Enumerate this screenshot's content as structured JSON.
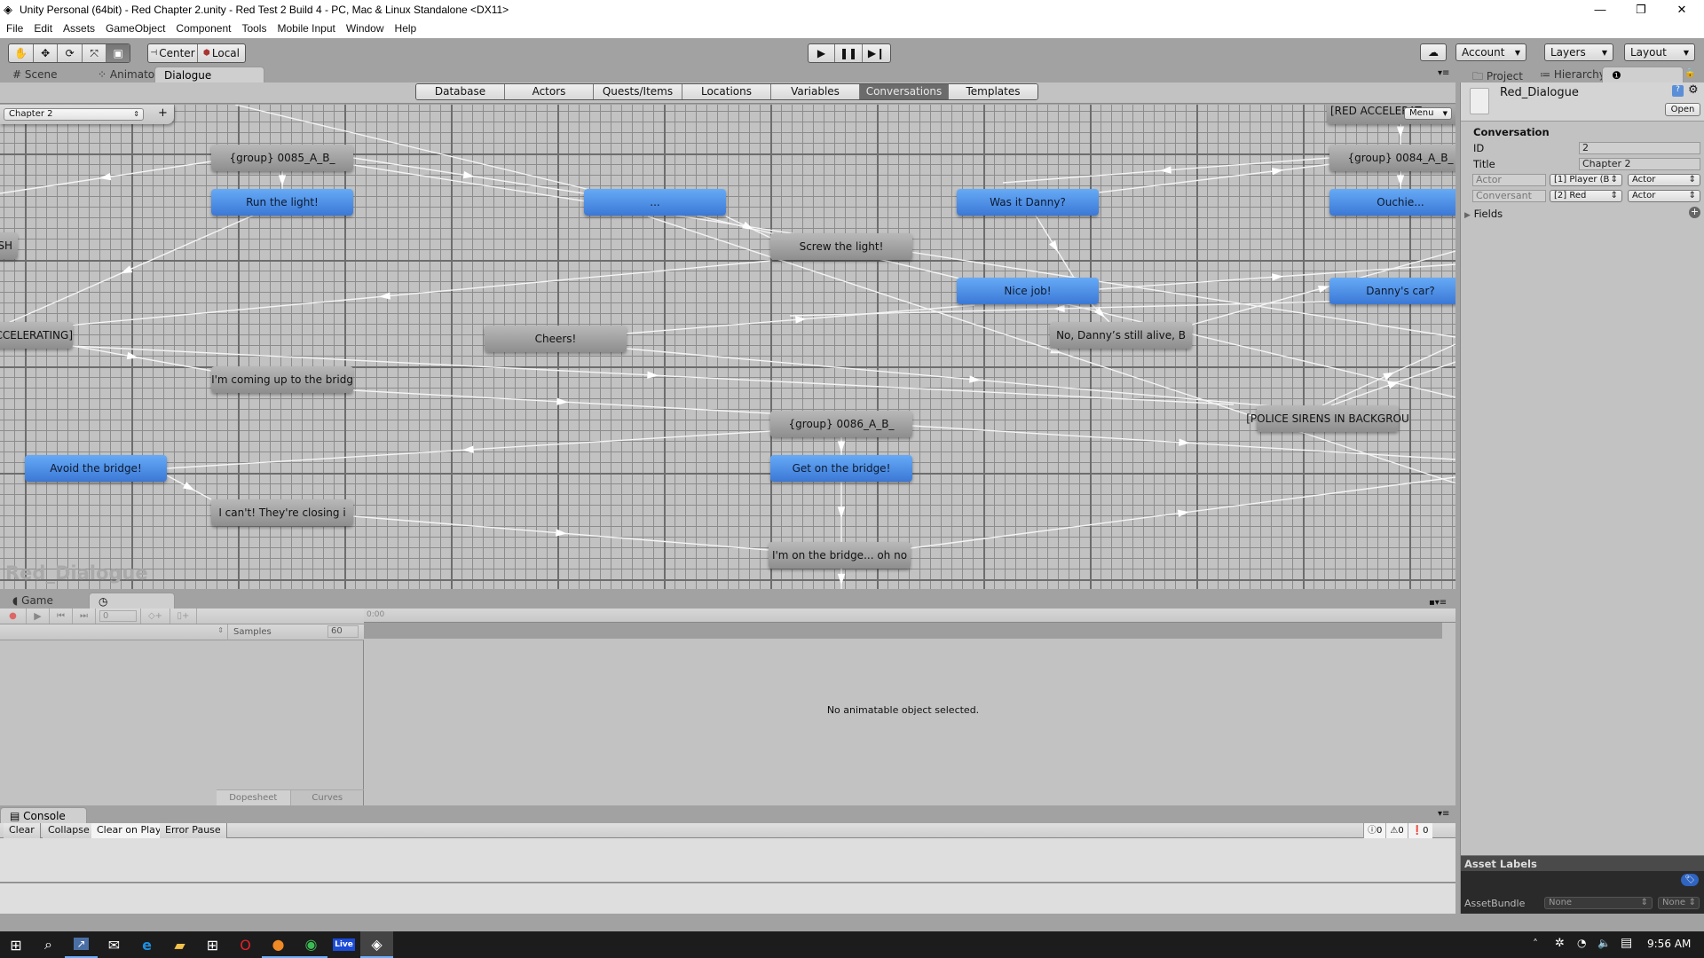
{
  "window": {
    "title": "Unity Personal (64bit) - Red Chapter 2.unity - Red Test 2 Build 4 - PC, Mac & Linux Standalone <DX11>",
    "minimize": "—",
    "restore": "❐",
    "close": "✕"
  },
  "menu": [
    "File",
    "Edit",
    "Assets",
    "GameObject",
    "Component",
    "Tools",
    "Mobile Input",
    "Window",
    "Help"
  ],
  "toolbar": {
    "tools": [
      "hand",
      "move",
      "rotate",
      "scale",
      "rect"
    ],
    "pivot": "Center",
    "space": "Local",
    "account": "Account",
    "layers": "Layers",
    "layout": "Layout"
  },
  "scene_tabs": [
    "Scene",
    "Animator",
    "Dialogue"
  ],
  "database_tabs": [
    "Database",
    "Actors",
    "Quests/Items",
    "Locations",
    "Variables",
    "Conversations",
    "Templates"
  ],
  "active_database_tab": "Conversations",
  "graph": {
    "conversation_select": "Chapter 2",
    "add_label": "+",
    "menu_label": "Menu",
    "watermark": "Red_Dialogue",
    "nodes": [
      {
        "text": "{group} 0085_A_B_",
        "type": "gray"
      },
      {
        "text": "Run the light!",
        "type": "blue"
      },
      {
        "text": "...",
        "type": "blue"
      },
      {
        "text": "Was it Danny?",
        "type": "blue"
      },
      {
        "text": "[RED ACCELERAT",
        "type": "gray"
      },
      {
        "text": "{group} 0084_A_B_",
        "type": "gray"
      },
      {
        "text": "Ouchie...",
        "type": "blue"
      },
      {
        "text": "SMASH",
        "type": "gray"
      },
      {
        "text": "Screw the light!",
        "type": "gray"
      },
      {
        "text": "Nice job!",
        "type": "blue"
      },
      {
        "text": "Danny's car?",
        "type": "blue"
      },
      {
        "text": "CCELERATING]",
        "type": "gray"
      },
      {
        "text": "Cheers!",
        "type": "gray"
      },
      {
        "text": "No, Danny’s still alive, B",
        "type": "gray"
      },
      {
        "text": "I'm coming up to the bridg",
        "type": "gray"
      },
      {
        "text": "{group} 0086_A_B_",
        "type": "gray"
      },
      {
        "text": "[POLICE SIRENS IN BACKGROU",
        "type": "gray"
      },
      {
        "text": "Avoid the bridge!",
        "type": "blue"
      },
      {
        "text": "Get on the bridge!",
        "type": "blue"
      },
      {
        "text": "I can't! They're closing i",
        "type": "gray"
      },
      {
        "text": "I'm on the bridge... oh no",
        "type": "gray"
      }
    ]
  },
  "inspector_tabs": [
    "Project",
    "Hierarchy",
    "Inspector"
  ],
  "inspector": {
    "asset_name": "Red_Dialogue",
    "open_label": "Open",
    "section": "Conversation",
    "id_label": "ID",
    "id_value": "2",
    "title_label": "Title",
    "title_value": "Chapter 2",
    "actor_label": "Actor",
    "actor_value": "[1] Player (B",
    "actor_type": "Actor",
    "conversant_label": "Conversant",
    "conversant_value": "[2] Red",
    "conversant_type": "Actor",
    "fields_label": "Fields",
    "asset_labels": "Asset Labels",
    "assetbundle_label": "AssetBundle",
    "assetbundle_value": "None",
    "assetbundle_variant": "None"
  },
  "bottom_tabs": [
    "Game",
    "Animation"
  ],
  "animation": {
    "frame": "0",
    "samples_label": "Samples",
    "samples": "60",
    "time": "0:00",
    "empty_message": "No animatable object selected.",
    "dopesheet": "Dopesheet",
    "curves": "Curves"
  },
  "console": {
    "tab": "Console",
    "buttons": [
      "Clear",
      "Collapse",
      "Clear on Play",
      "Error Pause"
    ],
    "info_count": "0",
    "warn_count": "0",
    "error_count": "0"
  },
  "taskbar": {
    "time": "9:56 AM",
    "live_label": "Live"
  }
}
